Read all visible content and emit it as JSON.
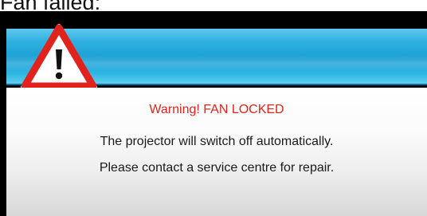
{
  "caption": "Fan failed:",
  "dialog": {
    "icon": "warning-triangle-icon",
    "title": "Warning! FAN LOCKED",
    "messages": [
      "The projector will switch off automatically.",
      "Please contact a service centre for repair."
    ]
  },
  "colors": {
    "header_blue": "#1a9fd3",
    "warning_red": "#e3231b",
    "icon_red": "#e0231c",
    "frame": "#000000"
  }
}
